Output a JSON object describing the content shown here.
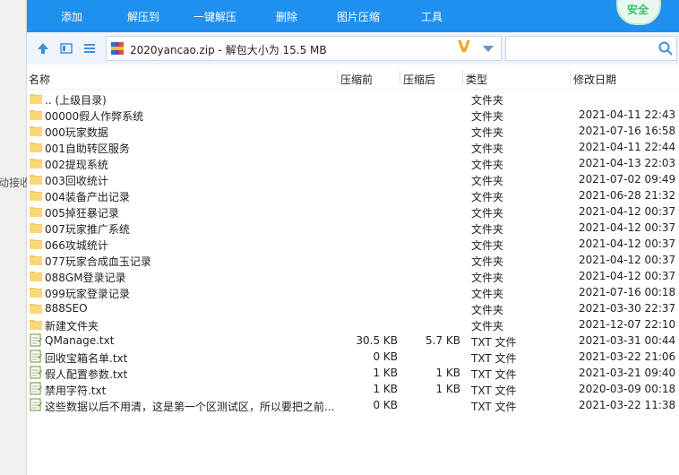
{
  "background": {
    "side_text": "动接收"
  },
  "toolbar": {
    "buttons": [
      {
        "label": "添加"
      },
      {
        "label": "解压到"
      },
      {
        "label": "一键解压"
      },
      {
        "label": "删除"
      },
      {
        "label": "图片压缩"
      },
      {
        "label": "工具"
      }
    ],
    "security_badge": "安全"
  },
  "address": {
    "path": "2020yancao.zip - 解包大小为 15.5 MB",
    "search_placeholder": ""
  },
  "columns": {
    "name": "名称",
    "before": "压缩前",
    "after": "压缩后",
    "type": "类型",
    "date": "修改日期"
  },
  "files": [
    {
      "icon": "folder-icon",
      "name": ".. (上级目录)",
      "before": "",
      "after": "",
      "type": "文件夹",
      "date": ""
    },
    {
      "icon": "folder-icon",
      "name": "00000假人作弊系统",
      "before": "",
      "after": "",
      "type": "文件夹",
      "date": "2021-04-11 22:43"
    },
    {
      "icon": "folder-icon",
      "name": "000玩家数据",
      "before": "",
      "after": "",
      "type": "文件夹",
      "date": "2021-07-16 16:58"
    },
    {
      "icon": "folder-icon",
      "name": "001自助转区服务",
      "before": "",
      "after": "",
      "type": "文件夹",
      "date": "2021-04-11 22:44"
    },
    {
      "icon": "folder-icon",
      "name": "002提现系统",
      "before": "",
      "after": "",
      "type": "文件夹",
      "date": "2021-04-13 22:03"
    },
    {
      "icon": "folder-icon",
      "name": "003回收统计",
      "before": "",
      "after": "",
      "type": "文件夹",
      "date": "2021-07-02 09:49"
    },
    {
      "icon": "folder-icon",
      "name": "004装备产出记录",
      "before": "",
      "after": "",
      "type": "文件夹",
      "date": "2021-06-28 21:32"
    },
    {
      "icon": "folder-icon",
      "name": "005掉狂暴记录",
      "before": "",
      "after": "",
      "type": "文件夹",
      "date": "2021-04-12 00:37"
    },
    {
      "icon": "folder-icon",
      "name": "007玩家推广系统",
      "before": "",
      "after": "",
      "type": "文件夹",
      "date": "2021-04-12 00:37"
    },
    {
      "icon": "folder-icon",
      "name": "066攻城统计",
      "before": "",
      "after": "",
      "type": "文件夹",
      "date": "2021-04-12 00:37"
    },
    {
      "icon": "folder-icon",
      "name": "077玩家合成血玉记录",
      "before": "",
      "after": "",
      "type": "文件夹",
      "date": "2021-04-12 00:37"
    },
    {
      "icon": "folder-icon",
      "name": "088GM登录记录",
      "before": "",
      "after": "",
      "type": "文件夹",
      "date": "2021-04-12 00:37"
    },
    {
      "icon": "folder-icon",
      "name": "099玩家登录记录",
      "before": "",
      "after": "",
      "type": "文件夹",
      "date": "2021-07-16 00:18"
    },
    {
      "icon": "folder-icon",
      "name": "888SEO",
      "before": "",
      "after": "",
      "type": "文件夹",
      "date": "2021-03-30 22:37"
    },
    {
      "icon": "folder-icon",
      "name": "新建文件夹",
      "before": "",
      "after": "",
      "type": "文件夹",
      "date": "2021-12-07 22:10"
    },
    {
      "icon": "text-file-icon",
      "name": "QManage.txt",
      "before": "30.5 KB",
      "after": "5.7 KB",
      "type": "TXT 文件",
      "date": "2021-03-31 00:44"
    },
    {
      "icon": "text-file-icon",
      "name": "回收宝箱名单.txt",
      "before": "0 KB",
      "after": "",
      "type": "TXT 文件",
      "date": "2021-03-22 21:06"
    },
    {
      "icon": "text-file-icon",
      "name": "假人配置参数.txt",
      "before": "1 KB",
      "after": "1 KB",
      "type": "TXT 文件",
      "date": "2021-03-21 09:40"
    },
    {
      "icon": "text-file-icon",
      "name": "禁用字符.txt",
      "before": "1 KB",
      "after": "1 KB",
      "type": "TXT 文件",
      "date": "2020-03-09 00:18"
    },
    {
      "icon": "text-file-icon",
      "name": "这些数据以后不用清，这是第一个区测试区，所以要把之前...",
      "before": "0 KB",
      "after": "",
      "type": "TXT 文件",
      "date": "2021-03-22 11:38"
    }
  ]
}
